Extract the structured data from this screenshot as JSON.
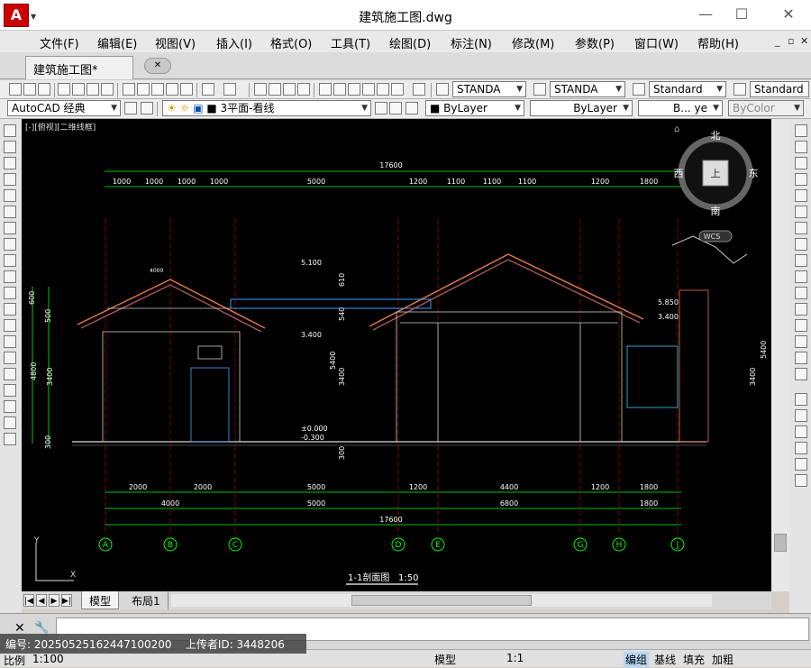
{
  "window": {
    "title": "建筑施工图.dwg",
    "app_logo": "A",
    "controls": [
      "—",
      "☐",
      "✕"
    ]
  },
  "menu": {
    "items": [
      "文件(F)",
      "编辑(E)",
      "视图(V)",
      "插入(I)",
      "格式(O)",
      "工具(T)",
      "绘图(D)",
      "标注(N)",
      "修改(M)",
      "参数(P)",
      "窗口(W)",
      "帮助(H)"
    ],
    "mdi_controls": [
      "_",
      "▫",
      "✕"
    ]
  },
  "tabs": {
    "document_tab": "建筑施工图*",
    "close_tab": "✕"
  },
  "toolbar_styles": {
    "text_style": "STANDA",
    "dim_style": "STANDA",
    "table_style": "Standard",
    "multileader_style": "Standard"
  },
  "toolbar_layers": {
    "workspace": "AutoCAD 经典",
    "layer": "3平面-看线",
    "color": "ByLayer",
    "linetype": "ByLayer",
    "lineweight": "B... ye",
    "plotstyle": "ByColor"
  },
  "viewport": {
    "label": "[-][俯视][二维线框]",
    "viewcube": {
      "north": "北",
      "south": "南",
      "east": "东",
      "west": "西",
      "top": "上",
      "wcs": "WCS"
    },
    "ucs": {
      "x": "X",
      "y": "Y"
    }
  },
  "drawing": {
    "title": "1-1剖面图",
    "scale": "1:50",
    "total_top": "17600",
    "top_dims": [
      "1000",
      "1000",
      "1000",
      "1000",
      "5000",
      "1200",
      "1100",
      "1100",
      "1100",
      "1200",
      "1800"
    ],
    "bottom_dims_row1": [
      "2000",
      "2000",
      "5000",
      "1200",
      "4400",
      "1200",
      "1800"
    ],
    "bottom_dims_row2": [
      "4000",
      "5000",
      "6800",
      "1800"
    ],
    "bottom_total": "17600",
    "grid_axes": [
      "A",
      "B",
      "C",
      "D",
      "E",
      "G",
      "H",
      "J"
    ],
    "left_dims": [
      "600",
      "500",
      "4800",
      "3400",
      "300"
    ],
    "mid_dims": [
      "610",
      "540",
      "5400",
      "3400",
      "300"
    ],
    "right_dims": [
      "5400",
      "3400"
    ],
    "elevations": [
      "5.100",
      "3.400",
      "±0.000",
      "-0.300",
      "5.850",
      "3.400"
    ],
    "annotation_text": "4000"
  },
  "layout_tabs": [
    "模型",
    "布局1"
  ],
  "command_line": {
    "close": "✕",
    "settings": "🔧"
  },
  "status": {
    "scale_label": "比例",
    "scale_value": "1:100",
    "model": "模型",
    "annotation_scale": "1:1",
    "buttons": [
      "编组",
      "基线",
      "填充",
      "加粗"
    ]
  },
  "watermark": {
    "id_label": "编号:",
    "id_value": "20250525162447100200",
    "uploader_label": "上传者ID:",
    "uploader_value": "3448206"
  }
}
